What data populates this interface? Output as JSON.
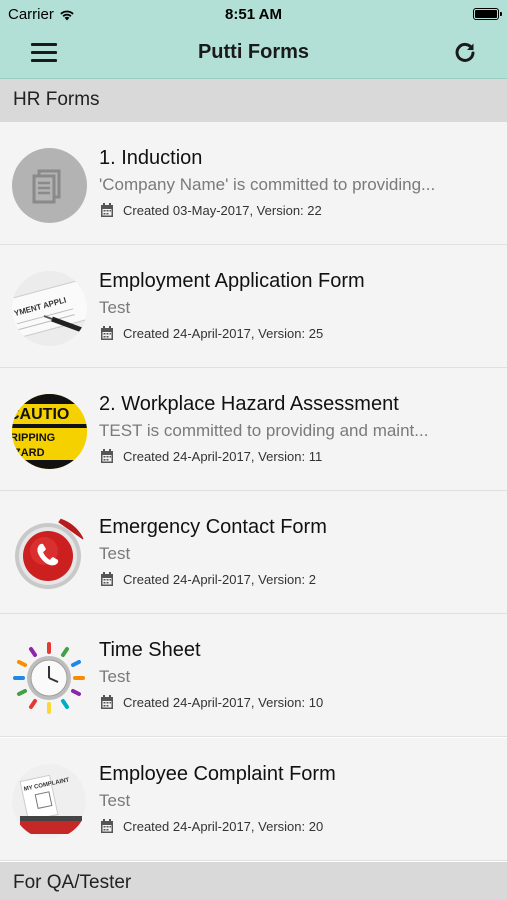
{
  "status_bar": {
    "carrier": "Carrier",
    "time": "8:51 AM"
  },
  "nav": {
    "title": "Putti Forms"
  },
  "sections": [
    {
      "title": "HR Forms"
    },
    {
      "title": "For QA/Tester"
    }
  ],
  "forms": [
    {
      "title": "1. Induction",
      "description": "'Company Name' is committed to providing...",
      "meta": "Created 03-May-2017, Version: 22",
      "icon": "document-icon"
    },
    {
      "title": "Employment Application Form",
      "description": "Test",
      "meta": "Created 24-April-2017, Version: 25",
      "icon": "employment-application-image"
    },
    {
      "title": "2. Workplace Hazard Assessment",
      "description": "TEST is committed to providing and maint...",
      "meta": "Created 24-April-2017, Version: 11",
      "icon": "caution-sign-image"
    },
    {
      "title": "Emergency Contact Form",
      "description": "Test",
      "meta": "Created 24-April-2017, Version: 2",
      "icon": "emergency-phone-image"
    },
    {
      "title": "Time Sheet",
      "description": "Test",
      "meta": "Created 24-April-2017, Version: 10",
      "icon": "clock-image"
    },
    {
      "title": "Employee Complaint Form",
      "description": "Test",
      "meta": "Created 24-April-2017, Version: 20",
      "icon": "complaint-box-image"
    }
  ],
  "colors": {
    "header_bg": "#b3e0d6",
    "section_bg": "#d9d9d9",
    "item_bg": "#f4f4f4"
  }
}
